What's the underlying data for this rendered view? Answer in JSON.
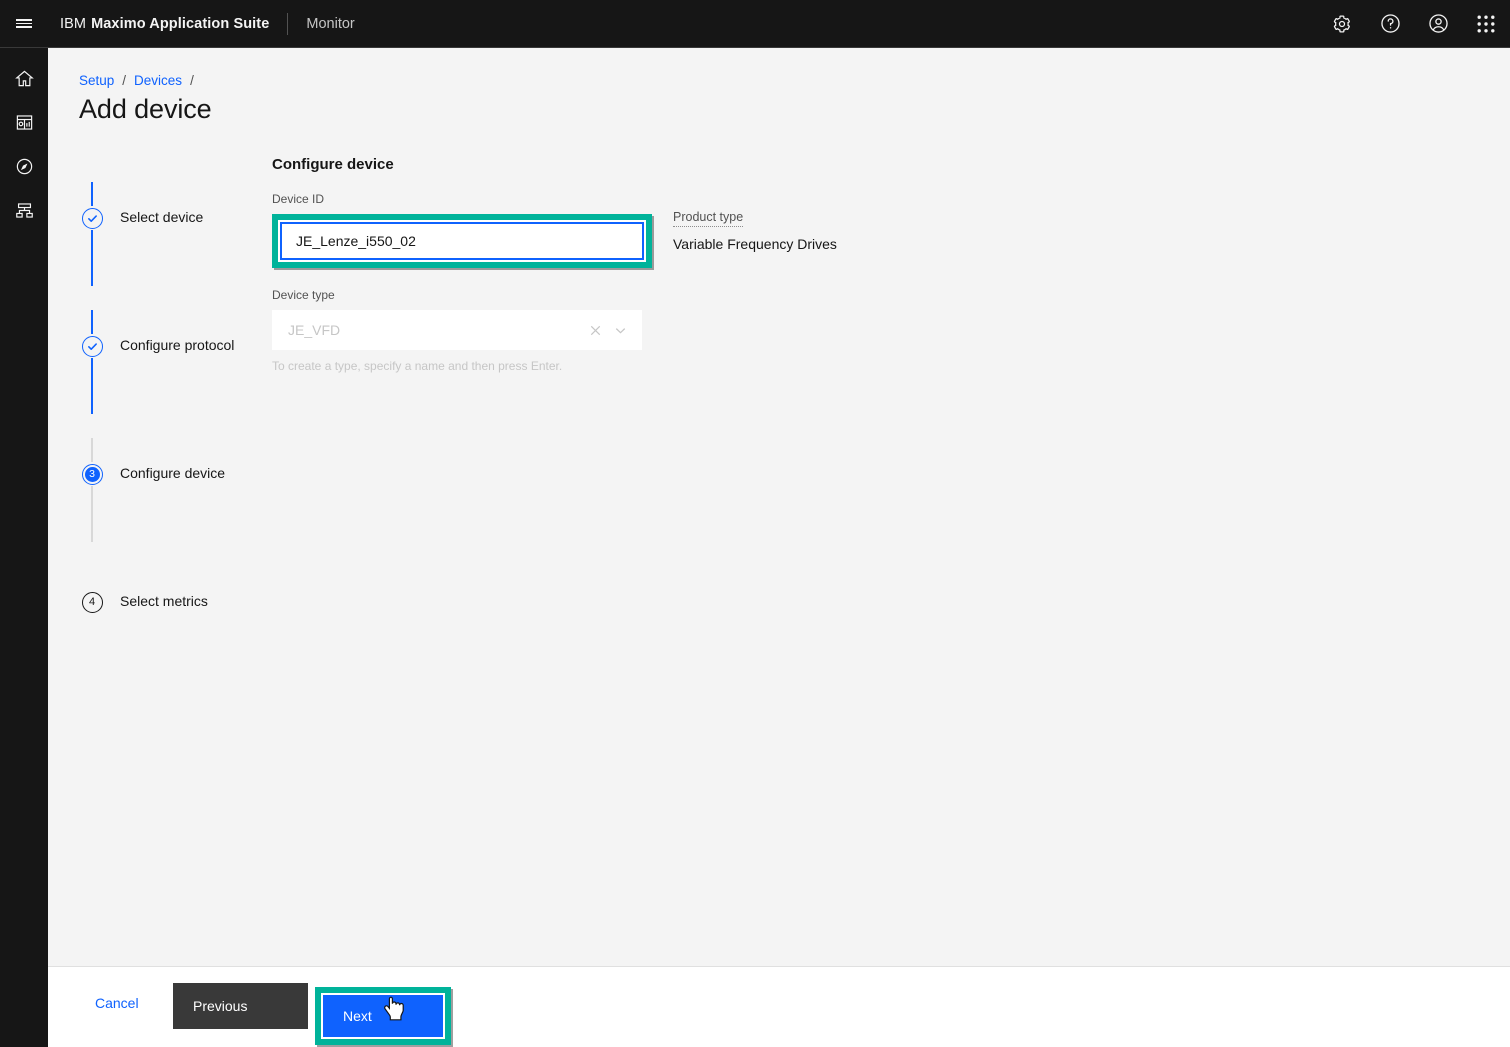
{
  "header": {
    "menu_icon": "hamburger-icon",
    "brand_prefix": "IBM",
    "brand_name": "Maximo Application Suite",
    "app_name": "Monitor",
    "icons": [
      {
        "name": "settings-icon",
        "label": "Settings"
      },
      {
        "name": "help-icon",
        "label": "Help"
      },
      {
        "name": "user-avatar-icon",
        "label": "User profile"
      },
      {
        "name": "app-switcher-icon",
        "label": "App switcher"
      }
    ]
  },
  "rail": {
    "items": [
      {
        "name": "home-icon",
        "label": "Home"
      },
      {
        "name": "dashboard-icon",
        "label": "Dashboards"
      },
      {
        "name": "explore-icon",
        "label": "Explore"
      },
      {
        "name": "hierarchy-icon",
        "label": "Setup"
      }
    ]
  },
  "breadcrumb": {
    "items": [
      "Setup",
      "Devices"
    ],
    "separator": "/",
    "trailing_separator": "/"
  },
  "page": {
    "title": "Add device"
  },
  "stepper": {
    "steps": [
      {
        "label": "Select device",
        "state": "complete",
        "marker": "check"
      },
      {
        "label": "Configure protocol",
        "state": "complete",
        "marker": "check"
      },
      {
        "label": "Configure device",
        "state": "current",
        "marker": "3"
      },
      {
        "label": "Select metrics",
        "state": "incomplete",
        "marker": "4"
      }
    ]
  },
  "form": {
    "heading": "Configure device",
    "device_id": {
      "label": "Device ID",
      "value": "JE_Lenze_i550_02",
      "placeholder": "Device ID",
      "highlighted": true
    },
    "device_type": {
      "label": "Device type",
      "value": "JE_VFD",
      "clear_icon": "close-icon",
      "expand_icon": "chevron-down-icon",
      "helper_text": "To create a type, specify a name and then press Enter."
    },
    "product_type": {
      "label": "Product type",
      "value": "Variable Frequency Drives"
    }
  },
  "footer": {
    "cancel_label": "Cancel",
    "previous_label": "Previous",
    "next_label": "Next",
    "next_highlighted": true
  },
  "cursor": {
    "type": "pointer-hand-cursor"
  },
  "colors": {
    "header_bg": "#161616",
    "content_bg": "#f4f4f4",
    "accent_blue": "#0f62fe",
    "highlight_teal": "#00b39a",
    "footer_bg": "#ffffff",
    "previous_btn": "#393939"
  }
}
